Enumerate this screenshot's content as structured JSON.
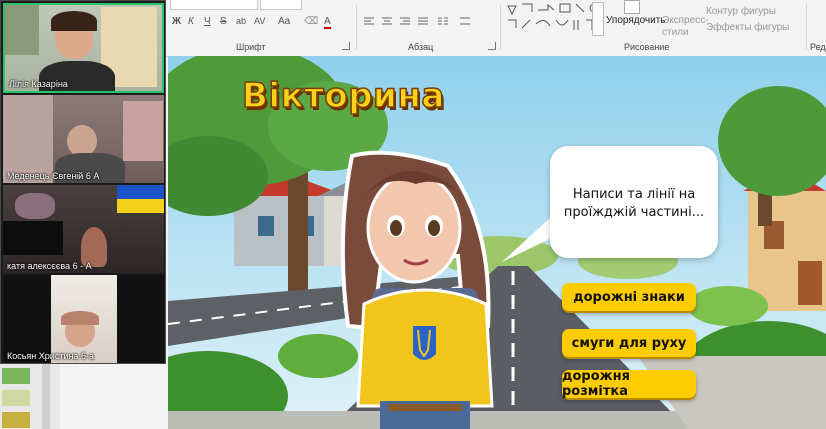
{
  "ribbon": {
    "font_group_label": "Шрифт",
    "paragraph_group_label": "Абзац",
    "drawing_group_label": "Рисование",
    "edit_group_label": "Ред",
    "font_buttons": [
      "Ж",
      "К",
      "Ч",
      "S",
      "ab",
      "AV",
      "Aa",
      "A"
    ],
    "arrange_label": "Упорядочить",
    "quick_styles_label": "Экспресс-стили",
    "shape_outline_label": "Контур фигуры",
    "shape_effects_label": "Эффекты фигуры"
  },
  "participants": [
    {
      "name": "Лілія Казаріна"
    },
    {
      "name": "Меденець Євгеній 6 А"
    },
    {
      "name": "катя алексєєва 6 - А"
    },
    {
      "name": "Косьян Христина 6-а"
    }
  ],
  "slide": {
    "title": "Вікторина",
    "bubble_text": "Написи та лінії на проїжджій частині...",
    "answers": [
      "дорожні знаки",
      "смуги для руху",
      "дорожня розмітка"
    ]
  },
  "colors": {
    "active_speaker_border": "#27c46b",
    "answer_button": "#ffcc00",
    "title_yellow": "#ffd21a"
  }
}
